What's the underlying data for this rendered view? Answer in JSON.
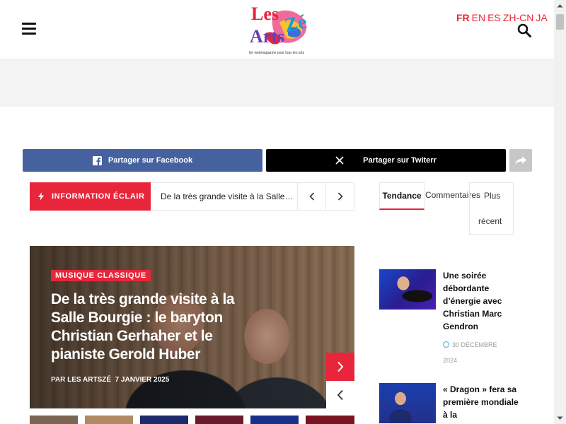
{
  "header": {
    "logo_alt": "Les ArtsZé",
    "logo_tagline": "Un webmagazine pour tous les arts",
    "languages": [
      "FR",
      "EN",
      "ES",
      "ZH-CN",
      "JA"
    ],
    "active_language": "FR"
  },
  "share": {
    "facebook_label": "Partager sur Facebook",
    "twitter_label": "Partager sur Twiterr"
  },
  "ticker": {
    "label": "INFORMATION ÉCLAIR",
    "headline": "De la très grande visite à la Salle Bourgie : le baryton Christian Gerhaher et le pianiste Gerold Huber"
  },
  "hero": {
    "category": "MUSIQUE CLASSIQUE",
    "title": "De la très grande visite à la Salle Bourgie : le baryton Christian Gerhaher et le pianiste Gerold Huber",
    "by_label": "PAR",
    "author": "LES ARTSZÉ",
    "date": "7 JANVIER 2025"
  },
  "sidebar": {
    "tabs": {
      "trending": "Tendance",
      "comments": "Commentaires",
      "recent_line1": "Plus",
      "recent_line2": "récent"
    },
    "posts": [
      {
        "title": "Une soirée débordante d’énergie avec Christian Marc Gendron",
        "date_line1": "30 DÉCEMBRE",
        "date_line2": "2024"
      },
      {
        "title": "« Dragon » fera sa première mondiale à la"
      }
    ]
  },
  "colors": {
    "accent": "#e8253a",
    "facebook": "#45629f",
    "twitter": "#000000",
    "date_icon": "#2bb3d8"
  }
}
